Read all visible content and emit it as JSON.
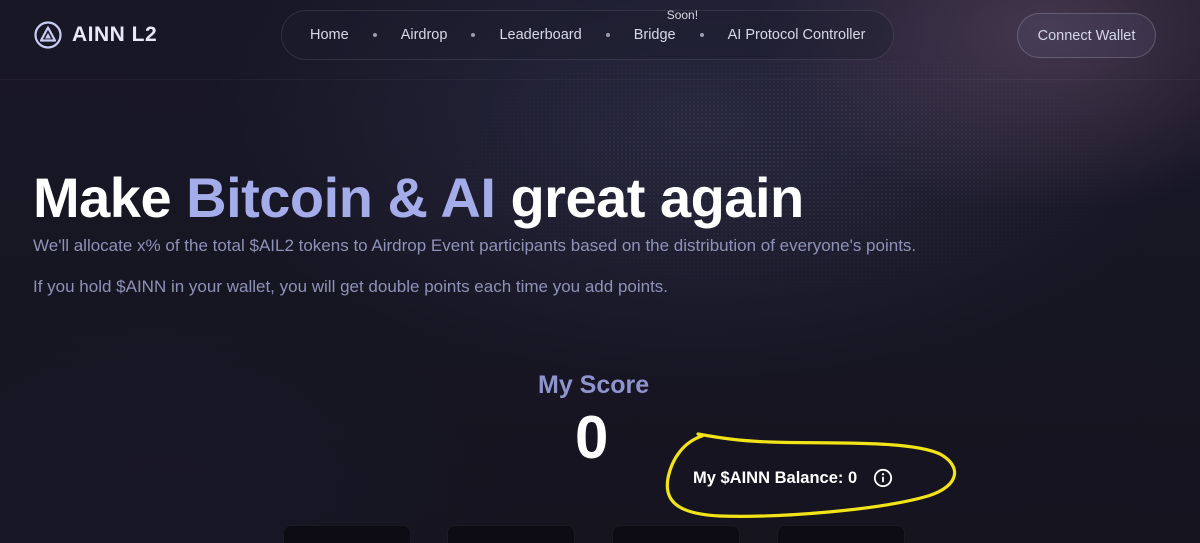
{
  "header": {
    "logo_text": "AINN L2",
    "nav": [
      {
        "label": "Home"
      },
      {
        "label": "Airdrop"
      },
      {
        "label": "Leaderboard"
      },
      {
        "label": "Bridge",
        "badge": "Soon!"
      },
      {
        "label": "AI Protocol Controller"
      }
    ],
    "connect_label": "Connect Wallet"
  },
  "hero": {
    "title_part1": "Make ",
    "title_accent": "Bitcoin & AI",
    "title_part2": " great again",
    "description_1": "We'll allocate x% of the total $AIL2 tokens to Airdrop Event participants based on the distribution of everyone's points.",
    "description_2": "If you hold $AINN in your wallet, you will get double points each time you add points."
  },
  "score": {
    "label": "My Score",
    "value": "0"
  },
  "balance": {
    "text": "My $AINN Balance: 0",
    "icon": "info-icon"
  },
  "colors": {
    "background": "#15141f",
    "accent": "#a5acea",
    "score_label": "#8f94cf",
    "description": "#8f92b8",
    "highlight": "#f2e416"
  }
}
